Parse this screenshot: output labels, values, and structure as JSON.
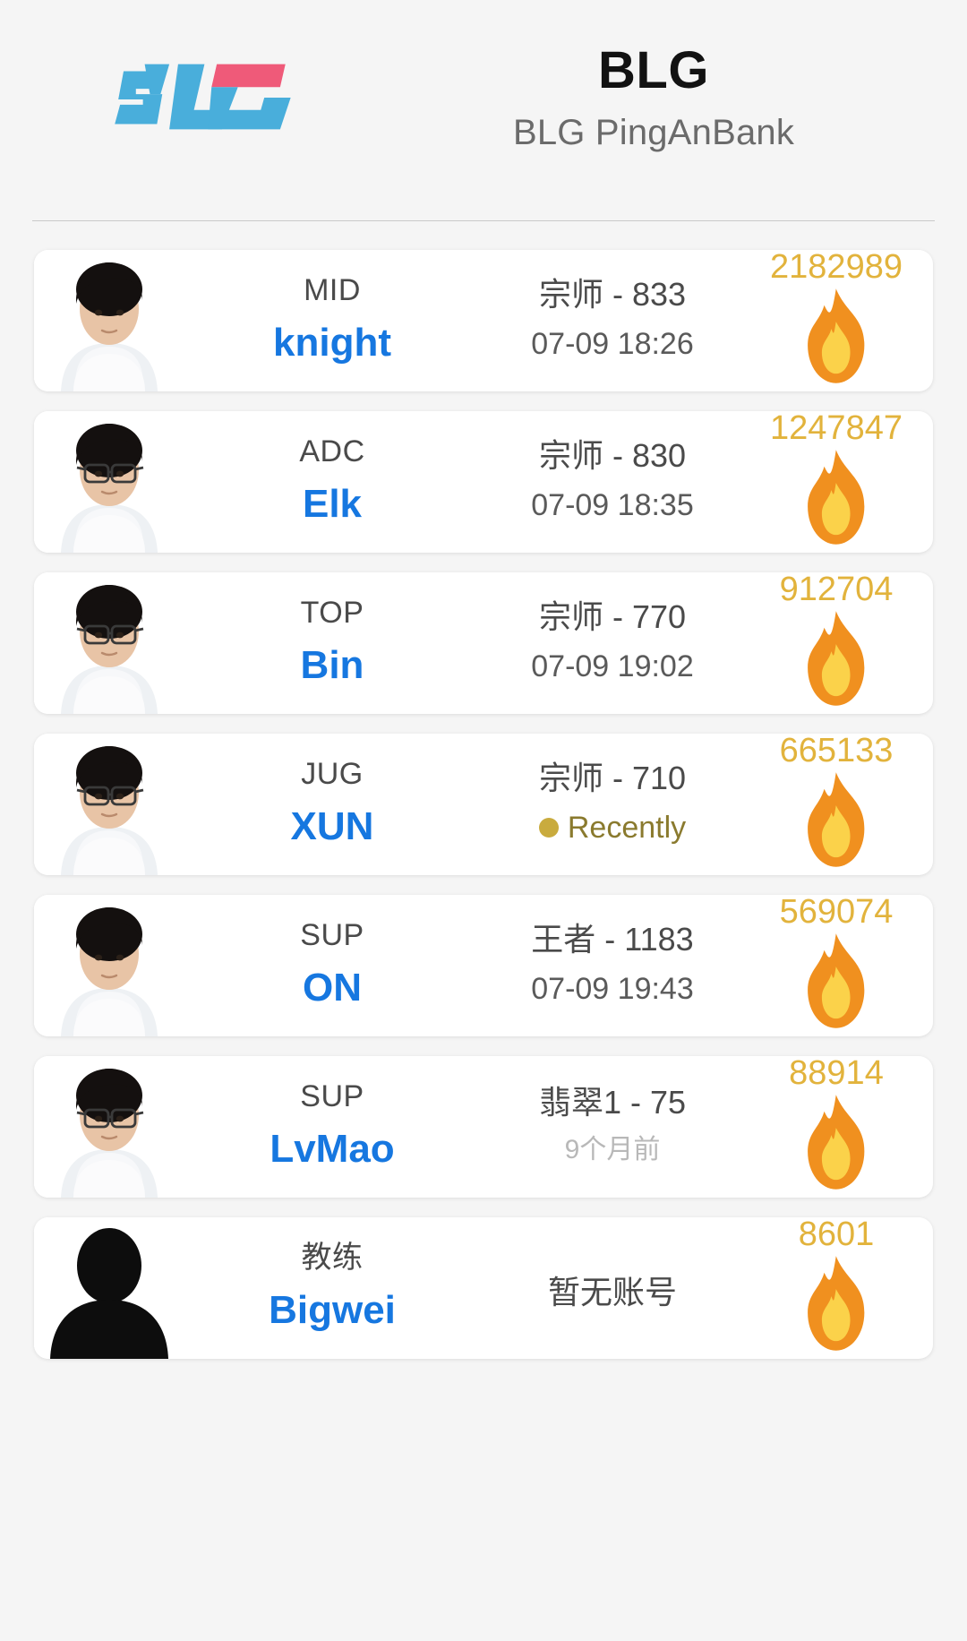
{
  "header": {
    "logo_icon": "blg-logo",
    "logo_colors": {
      "blue": "#49aedb",
      "pink": "#ef5a79"
    },
    "team_abbr": "BLG",
    "team_full": "BLG PingAnBank"
  },
  "colors": {
    "page_bg": "#f5f5f5",
    "card_bg": "#ffffff",
    "name_blue": "#1677e0",
    "score_gold": "#e2b33c",
    "flame_orange": "#f0901f",
    "recent_dot": "#c9ab3e",
    "muted_gray": "#b8b8b8"
  },
  "roster": [
    {
      "role": "MID",
      "name": "knight",
      "rank": "宗师 - 833",
      "timestamp": "07-09 18:26",
      "timestamp_style": "normal",
      "score": "2182989",
      "flame_icon": "flame-icon",
      "avatar_icon": "player-portrait"
    },
    {
      "role": "ADC",
      "name": "Elk",
      "rank": "宗师 - 830",
      "timestamp": "07-09 18:35",
      "timestamp_style": "normal",
      "score": "1247847",
      "flame_icon": "flame-icon",
      "avatar_icon": "player-portrait-glasses"
    },
    {
      "role": "TOP",
      "name": "Bin",
      "rank": "宗师 - 770",
      "timestamp": "07-09 19:02",
      "timestamp_style": "normal",
      "score": "912704",
      "flame_icon": "flame-icon",
      "avatar_icon": "player-portrait-glasses"
    },
    {
      "role": "JUG",
      "name": "XUN",
      "rank": "宗师 - 710",
      "timestamp": "Recently",
      "timestamp_style": "recent",
      "score": "665133",
      "flame_icon": "flame-icon",
      "avatar_icon": "player-portrait-glasses"
    },
    {
      "role": "SUP",
      "name": "ON",
      "rank": "王者 - 1183",
      "timestamp": "07-09 19:43",
      "timestamp_style": "normal",
      "score": "569074",
      "flame_icon": "flame-icon",
      "avatar_icon": "player-portrait"
    },
    {
      "role": "SUP",
      "name": "LvMao",
      "rank": "翡翠1 - 75",
      "timestamp": "9个月前",
      "timestamp_style": "muted",
      "score": "88914",
      "flame_icon": "flame-icon",
      "avatar_icon": "player-portrait-glasses"
    },
    {
      "role": "教练",
      "name": "Bigwei",
      "rank": "暂无账号",
      "timestamp": "",
      "timestamp_style": "none",
      "score": "8601",
      "flame_icon": "flame-icon",
      "avatar_icon": "player-portrait-silhouette"
    }
  ]
}
